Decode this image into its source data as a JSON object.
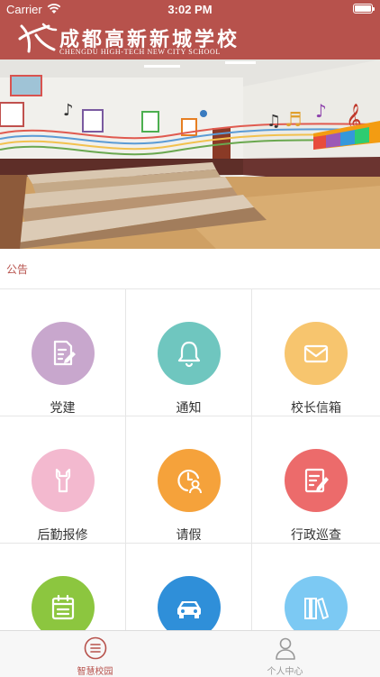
{
  "status_bar": {
    "carrier": "Carrier",
    "time": "3:02 PM"
  },
  "header": {
    "school_name_cn": "成都高新新城学校",
    "school_name_en": "CHENGDU HIGH-TECH NEW CITY SCHOOL",
    "background_color": "#b7524c"
  },
  "notice": {
    "label": "公告"
  },
  "grid": [
    {
      "label": "党建",
      "color": "#c8a7cd",
      "icon": "document-edit-icon"
    },
    {
      "label": "通知",
      "color": "#6fc6bf",
      "icon": "bell-icon"
    },
    {
      "label": "校长信箱",
      "color": "#f7c56e",
      "icon": "envelope-icon"
    },
    {
      "label": "后勤报修",
      "color": "#f3b9cf",
      "icon": "wrench-icon"
    },
    {
      "label": "请假",
      "color": "#f5a23b",
      "icon": "clock-person-icon"
    },
    {
      "label": "行政巡查",
      "color": "#ec6b6b",
      "icon": "clipboard-edit-icon"
    },
    {
      "label": "",
      "color": "#8cc63f",
      "icon": "calendar-icon"
    },
    {
      "label": "",
      "color": "#2f8fd9",
      "icon": "car-icon"
    },
    {
      "label": "",
      "color": "#7cc9f3",
      "icon": "books-icon"
    }
  ],
  "tabbar": {
    "tabs": [
      {
        "label": "智慧校园",
        "icon": "list-circle-icon",
        "active": true,
        "color": "#b7524c"
      },
      {
        "label": "个人中心",
        "icon": "person-icon",
        "active": false,
        "color": "#999999"
      }
    ]
  }
}
